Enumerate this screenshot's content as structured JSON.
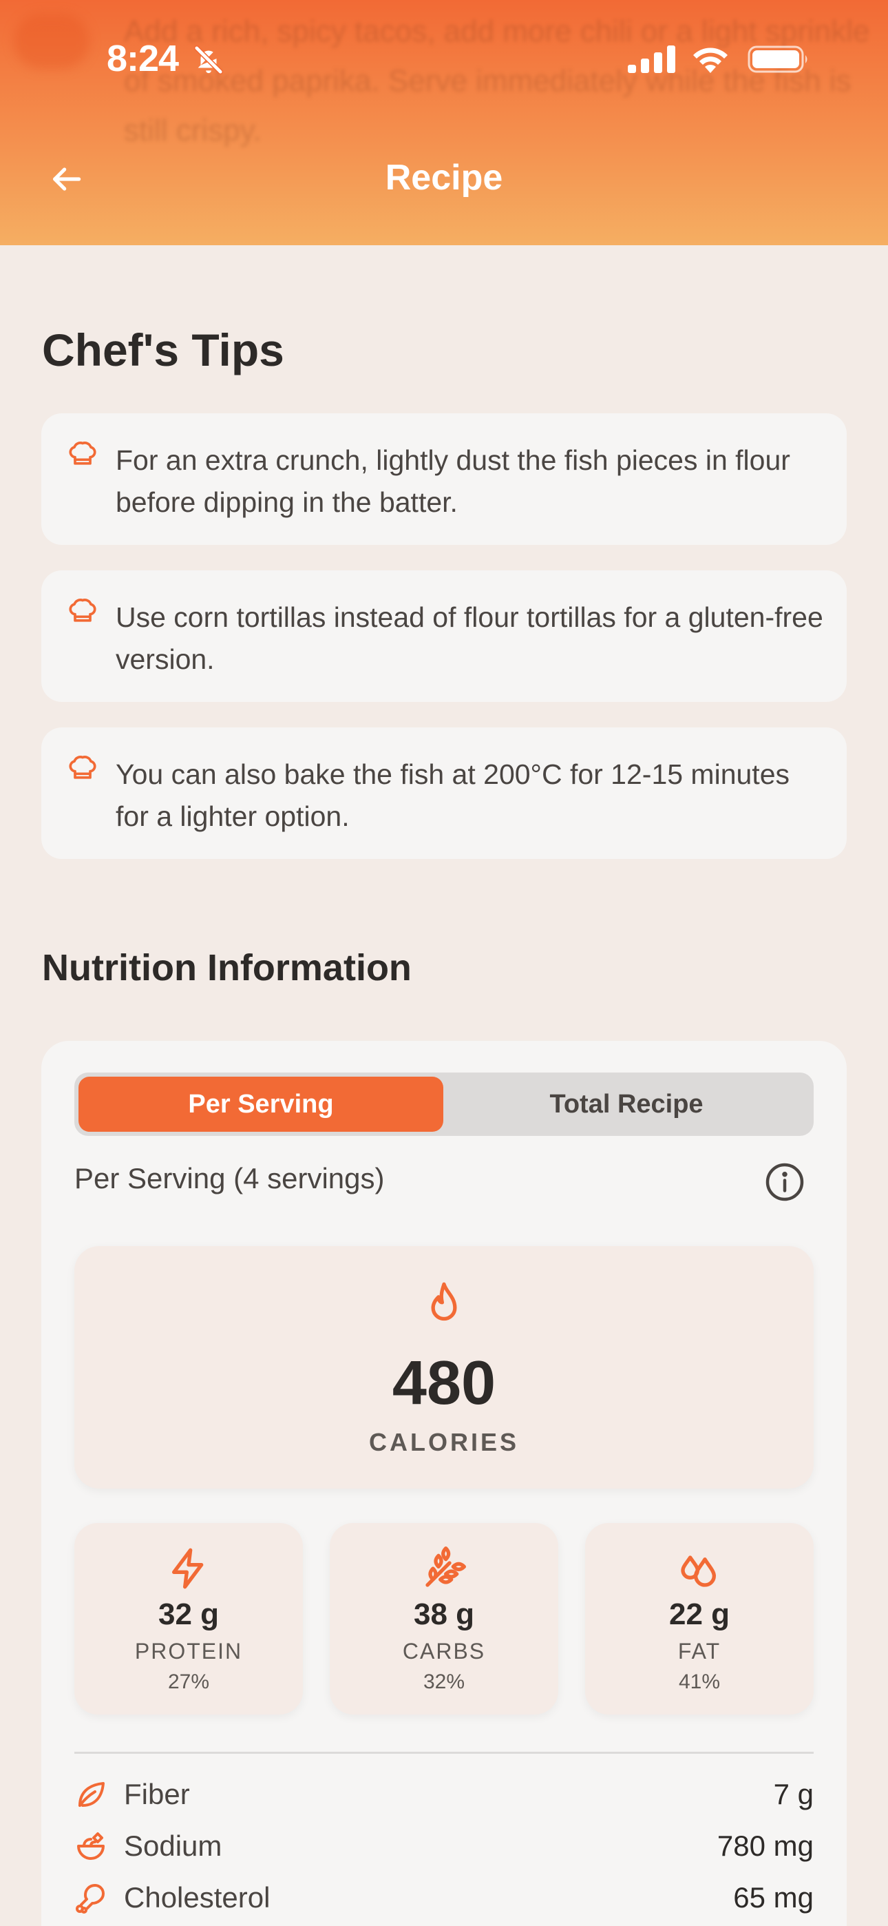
{
  "status_bar": {
    "time": "8:24"
  },
  "header": {
    "title": "Recipe",
    "background_text": "Add a rich, spicy tacos, add more chili or a light sprinkle of smoked paprika. Serve immediately while the fish is still crispy."
  },
  "tips_section": {
    "title": "Chef's Tips",
    "tips": [
      {
        "text": "For an extra crunch, lightly dust the fish pieces in flour before dipping in the batter."
      },
      {
        "text": "Use corn tortillas instead of flour tortillas for a gluten-free version."
      },
      {
        "text": "You can also bake the fish at 200°C for 12-15 minutes for a lighter option."
      }
    ]
  },
  "nutrition": {
    "title": "Nutrition Information",
    "tabs": {
      "per_serving": "Per Serving",
      "total_recipe": "Total Recipe",
      "active": "per_serving"
    },
    "serving_text": "Per Serving (4 servings)",
    "calories": {
      "value": "480",
      "label": "CALORIES"
    },
    "macros": [
      {
        "value": "32 g",
        "label": "PROTEIN",
        "percent": "27%",
        "icon": "lightning-icon"
      },
      {
        "value": "38 g",
        "label": "CARBS",
        "percent": "32%",
        "icon": "wheat-icon"
      },
      {
        "value": "22 g",
        "label": "FAT",
        "percent": "41%",
        "icon": "drops-icon"
      }
    ],
    "details": [
      {
        "label": "Fiber",
        "value": "7 g",
        "icon": "leaf-icon"
      },
      {
        "label": "Sodium",
        "value": "780 mg",
        "icon": "salt-bowl-icon"
      },
      {
        "label": "Cholesterol",
        "value": "65 mg",
        "icon": "drumstick-icon"
      }
    ]
  },
  "colors": {
    "accent": "#f26a35",
    "background": "#f3ebe6",
    "card": "#f6f5f4",
    "soft_card": "#f5ebe6"
  }
}
